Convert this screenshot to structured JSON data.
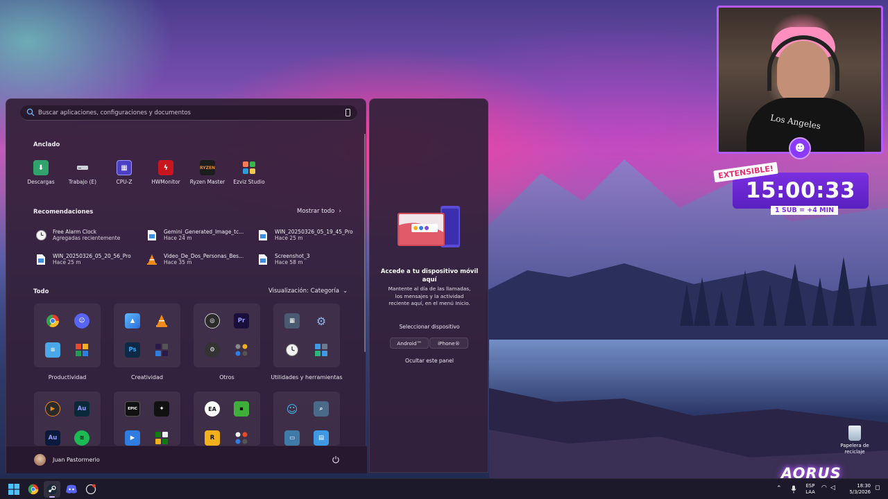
{
  "search": {
    "placeholder": "Buscar aplicaciones, configuraciones y documentos"
  },
  "pinned": {
    "title": "Anclado",
    "items": [
      {
        "label": "Descargas",
        "icon": "downloads-icon",
        "color": "#2fa36b"
      },
      {
        "label": "Trabajo (E)",
        "icon": "drive-icon",
        "color": "#c8c8d0"
      },
      {
        "label": "CPU-Z",
        "icon": "cpu-icon",
        "color": "#6a5cff"
      },
      {
        "label": "HWMonitor",
        "icon": "hwmonitor-icon",
        "color": "#d0202a"
      },
      {
        "label": "Ryzen Master",
        "icon": "ryzen-icon",
        "color": "#222222"
      },
      {
        "label": "Ezviz Studio",
        "icon": "ezviz-icon",
        "color": "#ffffff"
      }
    ]
  },
  "recommendations": {
    "title": "Recomendaciones",
    "show_all": "Mostrar todo",
    "items": [
      {
        "name": "Free Alarm Clock",
        "time": "Agregadas recientemente",
        "icon": "clock-icon"
      },
      {
        "name": "Gemini_Generated_Image_tc...",
        "time": "Hace 24 m",
        "icon": "image-file-icon"
      },
      {
        "name": "WIN_20250326_05_19_45_Pro",
        "time": "Hace 25 m",
        "icon": "image-file-icon"
      },
      {
        "name": "WIN_20250326_05_20_56_Pro",
        "time": "Hace 25 m",
        "icon": "image-file-icon"
      },
      {
        "name": "Video_De_Dos_Personas_Bes...",
        "time": "Hace 35 m",
        "icon": "vlc-icon"
      },
      {
        "name": "Screenshot_3",
        "time": "Hace 58 m",
        "icon": "image-file-icon"
      }
    ]
  },
  "all": {
    "title": "Todo",
    "view_label": "Visualización: Categoría",
    "folders": [
      {
        "label": "Productividad",
        "icons": [
          "chrome-icon",
          "discord-icon",
          "notepad-icon",
          "office-apps-icon"
        ]
      },
      {
        "label": "Creatividad",
        "icons": [
          "photos-icon",
          "vlc-icon",
          "photoshop-icon",
          "adobe-apps-icon"
        ]
      },
      {
        "label": "Otros",
        "icons": [
          "obs-icon",
          "premiere-icon",
          "cheat-icon",
          "misc-apps-icon"
        ]
      },
      {
        "label": "Utilidades y herramientas",
        "icons": [
          "calculator-icon",
          "settings-icon",
          "clock-icon",
          "tools-icon"
        ]
      },
      {
        "label": "",
        "icons": [
          "media-player-icon",
          "audition-icon",
          "audition-icon",
          "spotify-icon"
        ]
      },
      {
        "label": "",
        "icons": [
          "epic-games-icon",
          "game-icon",
          "video-icon",
          "xbox-icon"
        ]
      },
      {
        "label": "",
        "icons": [
          "ea-icon",
          "minecraft-icon",
          "rockstar-icon",
          "games-icon"
        ]
      },
      {
        "label": "",
        "icons": [
          "user-voice-icon",
          "search-app-icon",
          "remote-icon",
          "network-icon"
        ]
      }
    ],
    "folder_texts": {
      "photoshop": "Ps",
      "premiere": "Pr",
      "audition": "Au",
      "epic": "EPIC",
      "ea": "EA",
      "rockstar": "R"
    }
  },
  "user": {
    "name": "Juan Pastormerio"
  },
  "phone_panel": {
    "title": "Accede a tu dispositivo móvil aquí",
    "description": "Mantente al día de las llamadas, los mensajes y la actividad reciente aquí, en el menú Inicio.",
    "select_label": "Seleccionar dispositivo",
    "android": "Android™",
    "iphone": "iPhone®",
    "hide": "Ocultar este panel"
  },
  "overlay": {
    "timer": "15:00:33",
    "extensible": "EXTENSIBLE!",
    "sub_rule": "1 SUB = +4 MIN",
    "shirt_text": "Los Angeles"
  },
  "desktop": {
    "recycle_bin": "Papelera de reciclaje",
    "brand": "AORUS"
  },
  "taskbar": {
    "lang": "ESP",
    "region": "LAA",
    "time": "18:30",
    "date": "5/3/2026"
  },
  "colors": {
    "accent": "#b35cff",
    "panel": "#34203a"
  }
}
